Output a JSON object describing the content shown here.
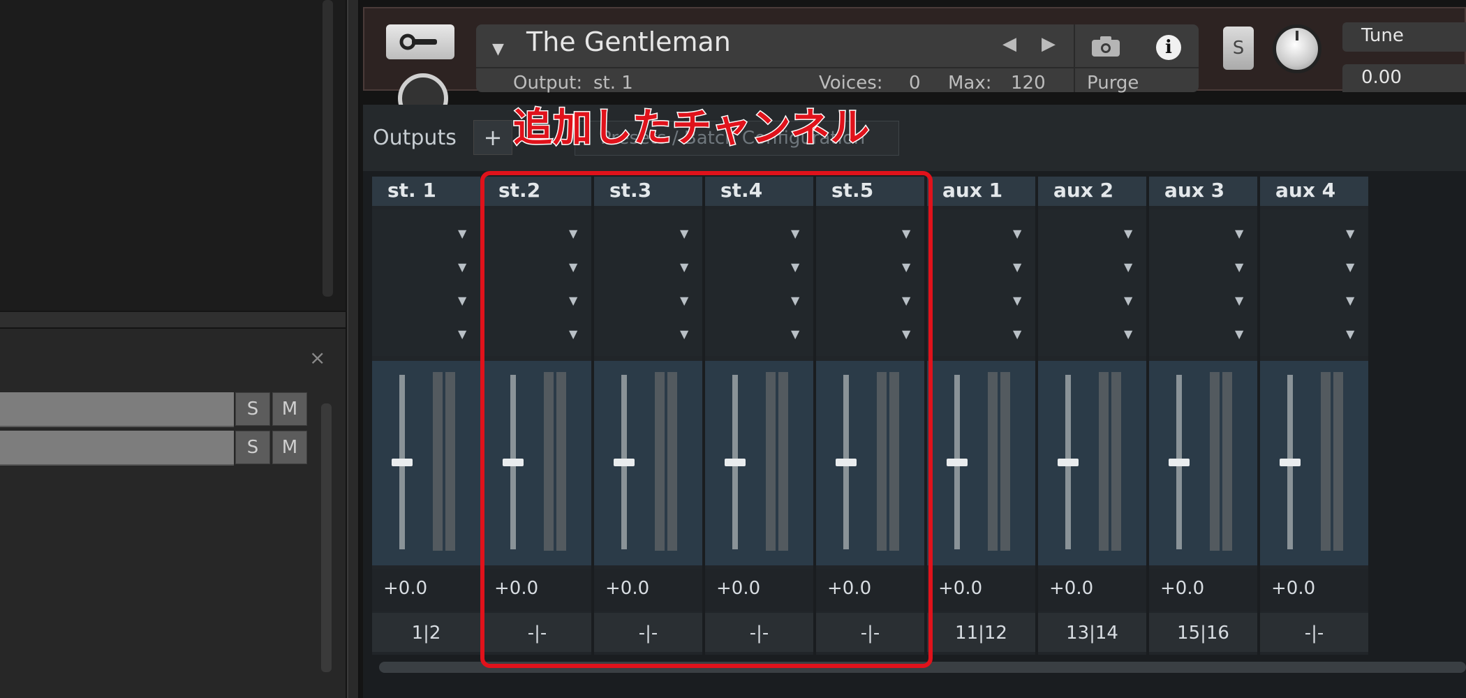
{
  "instrument": {
    "title": "The Gentleman",
    "output_label": "Output:",
    "output_value": "st. 1",
    "voices_label": "Voices:",
    "voices_value": "0",
    "max_label": "Max:",
    "max_value": "120",
    "purge_label": "Purge",
    "s_button": "S",
    "tune_label": "Tune",
    "tune_value": "0.00"
  },
  "left_panel": {
    "close_symbol": "×",
    "solo_label": "S",
    "mute_label": "M"
  },
  "outputs": {
    "label": "Outputs",
    "add_symbol": "+",
    "preset_text": "Presets / Batch Configuration"
  },
  "channels": [
    {
      "name": "st. 1",
      "value": "+0.0",
      "routing": "1|2",
      "fader_level": 0.52
    },
    {
      "name": "st.2",
      "value": "+0.0",
      "routing": "-|-",
      "fader_level": 0.52
    },
    {
      "name": "st.3",
      "value": "+0.0",
      "routing": "-|-",
      "fader_level": 0.52
    },
    {
      "name": "st.4",
      "value": "+0.0",
      "routing": "-|-",
      "fader_level": 0.52
    },
    {
      "name": "st.5",
      "value": "+0.0",
      "routing": "-|-",
      "fader_level": 0.52
    },
    {
      "name": "aux 1",
      "value": "+0.0",
      "routing": "11|12",
      "fader_level": 0.52
    },
    {
      "name": "aux 2",
      "value": "+0.0",
      "routing": "13|14",
      "fader_level": 0.52
    },
    {
      "name": "aux 3",
      "value": "+0.0",
      "routing": "15|16",
      "fader_level": 0.52
    },
    {
      "name": "aux 4",
      "value": "+0.0",
      "routing": "-|-",
      "fader_level": 0.52
    }
  ],
  "annotation": {
    "text": "追加したチャンネル",
    "color": "#e0121b"
  }
}
